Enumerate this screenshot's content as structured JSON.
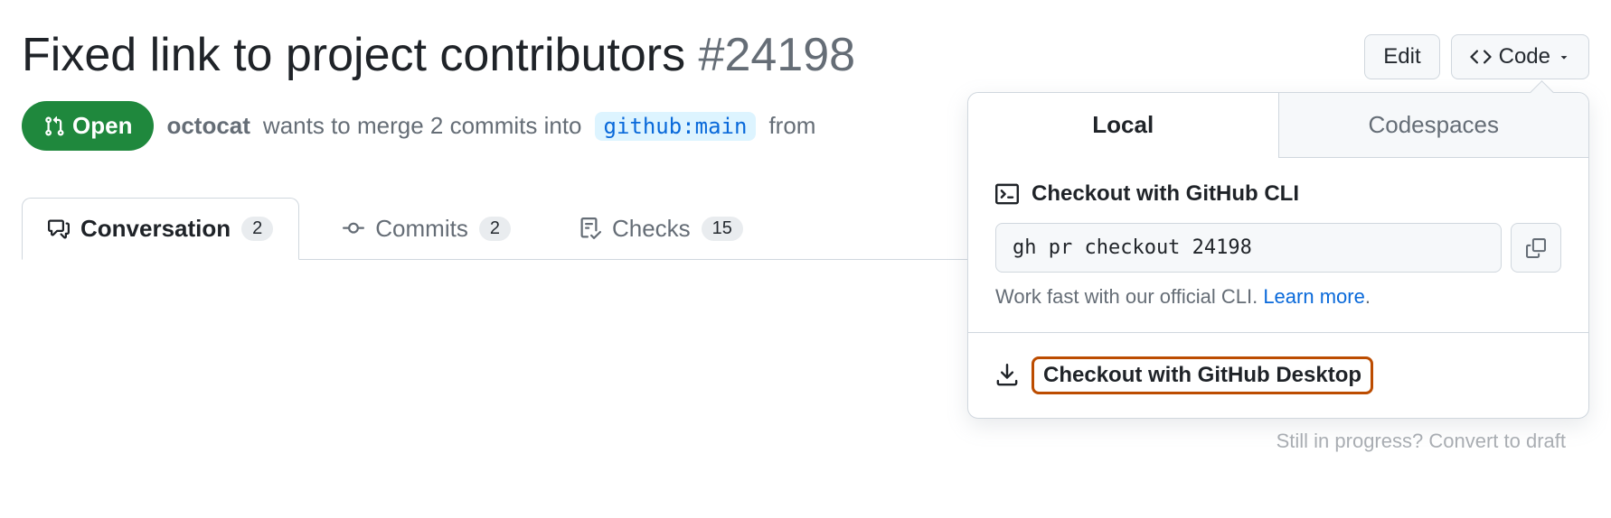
{
  "title": "Fixed link to project contributors",
  "pr_number": "#24198",
  "actions": {
    "edit": "Edit",
    "code": "Code"
  },
  "state": {
    "label": "Open"
  },
  "meta": {
    "author": "octocat",
    "wants_merge_prefix": "wants to merge 2 commits into",
    "base_branch": "github:main",
    "from_text": "from"
  },
  "tabs": [
    {
      "label": "Conversation",
      "count": "2"
    },
    {
      "label": "Commits",
      "count": "2"
    },
    {
      "label": "Checks",
      "count": "15"
    }
  ],
  "panel": {
    "tab_local": "Local",
    "tab_codespaces": "Codespaces",
    "cli_title": "Checkout with GitHub CLI",
    "cli_command": "gh pr checkout 24198",
    "cli_helper": "Work fast with our official CLI.",
    "cli_learn_more": "Learn more",
    "desktop_title": "Checkout with GitHub Desktop"
  },
  "below": {
    "prompt": "Still in progress?",
    "link": "Convert to draft"
  }
}
